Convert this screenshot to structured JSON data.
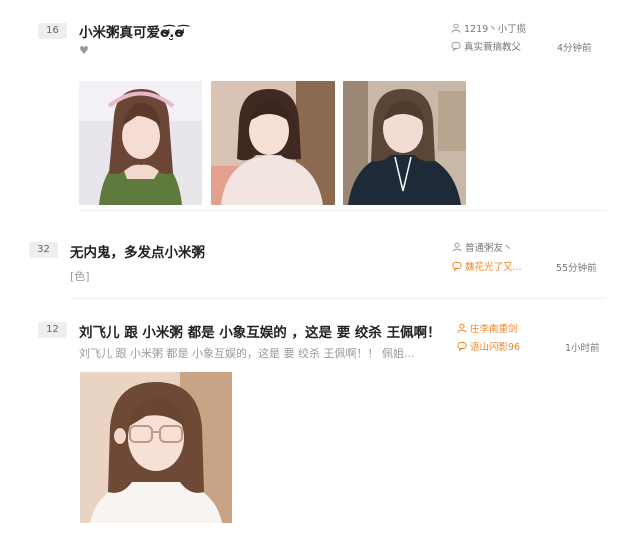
{
  "posts": [
    {
      "rank": "16",
      "title": "小米粥真可爱ơ̴̴̴̴̴̴͡.̮ơ̴̴̴̴̴̴͡",
      "heart": "♥",
      "author": "1219丶小丁揽",
      "last_reply": "真实蓑搞教父",
      "time": "4分钟前",
      "image_count": 3
    },
    {
      "rank": "32",
      "title": "无内鬼，多发点小米粥",
      "excerpt": "[色]",
      "author": "普通粥友丶",
      "last_reply": "魏花光了又...",
      "time": "55分钟前"
    },
    {
      "rank": "12",
      "title": "刘飞儿 跟 小米粥 都是 小象互娱的 ，这是 要 绞杀 王佩啊！",
      "excerpt": "刘飞儿 跟 小米粥 都是 小象互娱的，这是 要 绞杀 王佩啊！！ 佩姐...",
      "author": "庄李南重剑",
      "last_reply": "语山闪影96",
      "time": "1小时前",
      "image_count": 1
    }
  ],
  "colors": {
    "accent_orange": "#f0862a",
    "rank_bg": "#eeeeee"
  }
}
